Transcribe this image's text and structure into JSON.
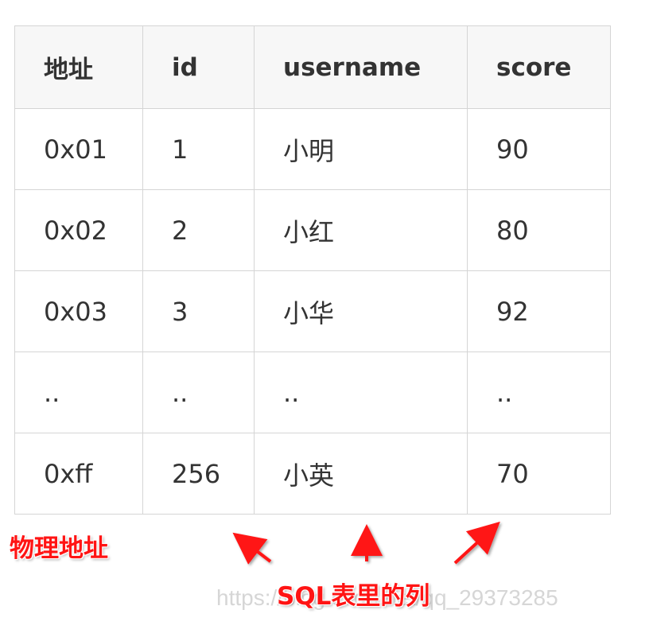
{
  "table": {
    "headers": [
      "地址",
      "id",
      "username",
      "score"
    ],
    "rows": [
      [
        "0x01",
        "1",
        "小明",
        "90"
      ],
      [
        "0x02",
        "2",
        "小红",
        "80"
      ],
      [
        "0x03",
        "3",
        "小华",
        "92"
      ],
      [
        "..",
        "..",
        "..",
        ".."
      ],
      [
        "0xff",
        "256",
        "小英",
        "70"
      ]
    ]
  },
  "annotations": {
    "physical_address": "物理地址",
    "sql_columns": "SQL表里的列"
  },
  "watermark": "https://blog.csdn.net/qq_29373285",
  "colors": {
    "annotation": "#ff1414",
    "border": "#d5d5d5",
    "header_bg": "#f7f7f7",
    "text": "#333333"
  }
}
